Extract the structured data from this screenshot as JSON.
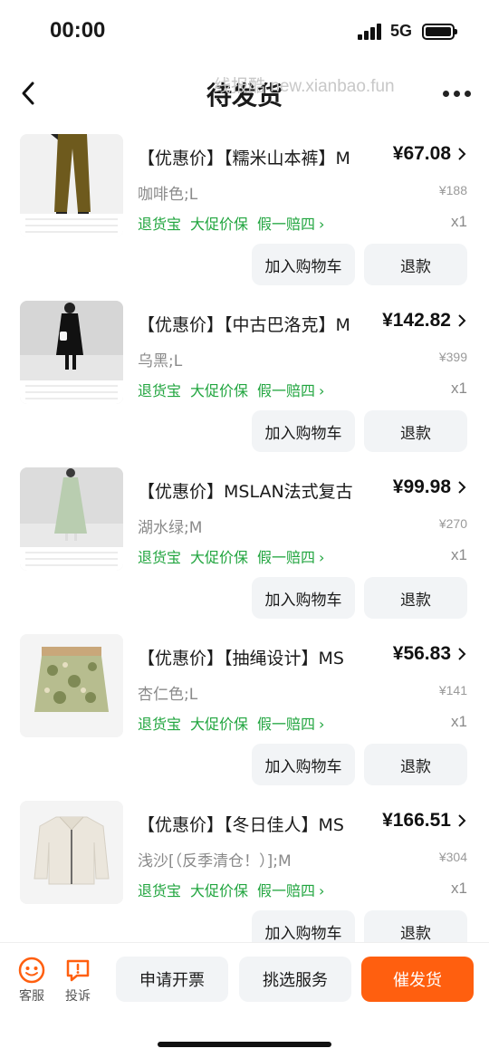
{
  "status": {
    "time": "00:00",
    "network": "5G"
  },
  "nav": {
    "title": "待发货",
    "watermark": "线报酷 new.xianbao.fun"
  },
  "items": [
    {
      "title": "【优惠价】【糯米山本裤】M",
      "price": "¥67.08",
      "variant": "咖啡色;L",
      "original_price": "¥188",
      "quantity": "x1",
      "tags": [
        "退货宝",
        "大促价保",
        "假一赔四"
      ],
      "cart_label": "加入购物车",
      "refund_label": "退款",
      "image": "brown-trousers-product-image"
    },
    {
      "title": "【优惠价】【中古巴洛克】M",
      "price": "¥142.82",
      "variant": "乌黑;L",
      "original_price": "¥399",
      "quantity": "x1",
      "tags": [
        "退货宝",
        "大促价保",
        "假一赔四"
      ],
      "cart_label": "加入购物车",
      "refund_label": "退款",
      "image": "black-dress-product-image"
    },
    {
      "title": "【优惠价】MSLAN法式复古",
      "price": "¥99.98",
      "variant": "湖水绿;M",
      "original_price": "¥270",
      "quantity": "x1",
      "tags": [
        "退货宝",
        "大促价保",
        "假一赔四"
      ],
      "cart_label": "加入购物车",
      "refund_label": "退款",
      "image": "green-dress-product-image"
    },
    {
      "title": "【优惠价】【抽绳设计】MS",
      "price": "¥56.83",
      "variant": "杏仁色;L",
      "original_price": "¥141",
      "quantity": "x1",
      "tags": [
        "退货宝",
        "大促价保",
        "假一赔四"
      ],
      "cart_label": "加入购物车",
      "refund_label": "退款",
      "image": "floral-skirt-product-image"
    },
    {
      "title": "【优惠价】【冬日佳人】MS",
      "price": "¥166.51",
      "variant": "浅沙[（反季清仓！）];M",
      "original_price": "¥304",
      "quantity": "x1",
      "tags": [
        "退货宝",
        "大促价保",
        "假一赔四"
      ],
      "cart_label": "加入购物车",
      "refund_label": "退款",
      "image": "cream-jacket-product-image"
    }
  ],
  "bottom": {
    "service_label": "客服",
    "complaint_label": "投诉",
    "invoice_label": "申请开票",
    "select_service_label": "挑选服务",
    "urge_label": "催发货",
    "accent_color": "#ff5f0f",
    "tag_color": "#21a53f"
  }
}
